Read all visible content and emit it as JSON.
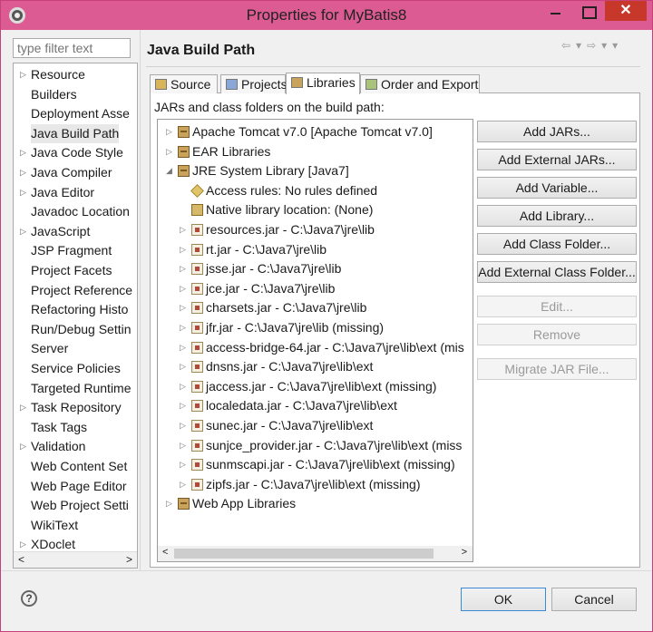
{
  "window": {
    "title": "Properties for MyBatis8",
    "close_glyph": "✕"
  },
  "filter": {
    "placeholder": "type filter text"
  },
  "nav": {
    "items": [
      {
        "label": "Resource",
        "expandable": true
      },
      {
        "label": "Builders",
        "expandable": false
      },
      {
        "label": "Deployment Asse",
        "expandable": false
      },
      {
        "label": "Java Build Path",
        "expandable": false,
        "selected": true
      },
      {
        "label": "Java Code Style",
        "expandable": true
      },
      {
        "label": "Java Compiler",
        "expandable": true
      },
      {
        "label": "Java Editor",
        "expandable": true
      },
      {
        "label": "Javadoc Location",
        "expandable": false
      },
      {
        "label": "JavaScript",
        "expandable": true
      },
      {
        "label": "JSP Fragment",
        "expandable": false
      },
      {
        "label": "Project Facets",
        "expandable": false
      },
      {
        "label": "Project Reference",
        "expandable": false
      },
      {
        "label": "Refactoring Histo",
        "expandable": false
      },
      {
        "label": "Run/Debug Settin",
        "expandable": false
      },
      {
        "label": "Server",
        "expandable": false
      },
      {
        "label": "Service Policies",
        "expandable": false
      },
      {
        "label": "Targeted Runtime",
        "expandable": false
      },
      {
        "label": "Task Repository",
        "expandable": true
      },
      {
        "label": "Task Tags",
        "expandable": false
      },
      {
        "label": "Validation",
        "expandable": true
      },
      {
        "label": "Web Content Set",
        "expandable": false
      },
      {
        "label": "Web Page Editor",
        "expandable": false
      },
      {
        "label": "Web Project Setti",
        "expandable": false
      },
      {
        "label": "WikiText",
        "expandable": false
      },
      {
        "label": "XDoclet",
        "expandable": true
      }
    ]
  },
  "page": {
    "title": "Java Build Path",
    "tabs": [
      {
        "label": "Source"
      },
      {
        "label": "Projects"
      },
      {
        "label": "Libraries",
        "active": true
      },
      {
        "label": "Order and Export"
      }
    ],
    "build_path_label": "JARs and class folders on the build path:"
  },
  "tree": {
    "rows": [
      {
        "text": "Apache Tomcat v7.0 [Apache Tomcat v7.0]",
        "level": 0,
        "expander": "▷",
        "icon": "library-icon"
      },
      {
        "text": "EAR Libraries",
        "level": 0,
        "expander": "▷",
        "icon": "library-icon"
      },
      {
        "text": "JRE System Library [Java7]",
        "level": 0,
        "expander": "◢",
        "icon": "library-icon"
      },
      {
        "text": "Access rules: No rules defined",
        "level": 1,
        "expander": "",
        "icon": "access-rules-icon"
      },
      {
        "text": "Native library location: (None)",
        "level": 1,
        "expander": "",
        "icon": "native-library-icon"
      },
      {
        "text": "resources.jar - C:\\Java7\\jre\\lib",
        "level": 1,
        "expander": "▷",
        "icon": "jar-icon"
      },
      {
        "text": "rt.jar - C:\\Java7\\jre\\lib",
        "level": 1,
        "expander": "▷",
        "icon": "jar-icon"
      },
      {
        "text": "jsse.jar - C:\\Java7\\jre\\lib",
        "level": 1,
        "expander": "▷",
        "icon": "jar-icon"
      },
      {
        "text": "jce.jar - C:\\Java7\\jre\\lib",
        "level": 1,
        "expander": "▷",
        "icon": "jar-icon"
      },
      {
        "text": "charsets.jar - C:\\Java7\\jre\\lib",
        "level": 1,
        "expander": "▷",
        "icon": "jar-icon"
      },
      {
        "text": "jfr.jar - C:\\Java7\\jre\\lib (missing)",
        "level": 1,
        "expander": "▷",
        "icon": "jar-icon"
      },
      {
        "text": "access-bridge-64.jar - C:\\Java7\\jre\\lib\\ext (mis",
        "level": 1,
        "expander": "▷",
        "icon": "jar-icon"
      },
      {
        "text": "dnsns.jar - C:\\Java7\\jre\\lib\\ext",
        "level": 1,
        "expander": "▷",
        "icon": "jar-icon"
      },
      {
        "text": "jaccess.jar - C:\\Java7\\jre\\lib\\ext (missing)",
        "level": 1,
        "expander": "▷",
        "icon": "jar-icon"
      },
      {
        "text": "localedata.jar - C:\\Java7\\jre\\lib\\ext",
        "level": 1,
        "expander": "▷",
        "icon": "jar-icon"
      },
      {
        "text": "sunec.jar - C:\\Java7\\jre\\lib\\ext",
        "level": 1,
        "expander": "▷",
        "icon": "jar-icon"
      },
      {
        "text": "sunjce_provider.jar - C:\\Java7\\jre\\lib\\ext (miss",
        "level": 1,
        "expander": "▷",
        "icon": "jar-icon"
      },
      {
        "text": "sunmscapi.jar - C:\\Java7\\jre\\lib\\ext (missing)",
        "level": 1,
        "expander": "▷",
        "icon": "jar-icon"
      },
      {
        "text": "zipfs.jar - C:\\Java7\\jre\\lib\\ext (missing)",
        "level": 1,
        "expander": "▷",
        "icon": "jar-icon"
      },
      {
        "text": "Web App Libraries",
        "level": 0,
        "expander": "▷",
        "icon": "library-icon"
      }
    ]
  },
  "buttons": [
    {
      "label": "Add JARs...",
      "enabled": true
    },
    {
      "label": "Add External JARs...",
      "enabled": true
    },
    {
      "label": "Add Variable...",
      "enabled": true
    },
    {
      "label": "Add Library...",
      "enabled": true
    },
    {
      "label": "Add Class Folder...",
      "enabled": true
    },
    {
      "label": "Add External Class Folder...",
      "enabled": true
    },
    {
      "label": "Edit...",
      "enabled": false
    },
    {
      "label": "Remove",
      "enabled": false
    },
    {
      "label": "Migrate JAR File...",
      "enabled": false
    }
  ],
  "dialog": {
    "help": "?",
    "ok": "OK",
    "cancel": "Cancel"
  }
}
